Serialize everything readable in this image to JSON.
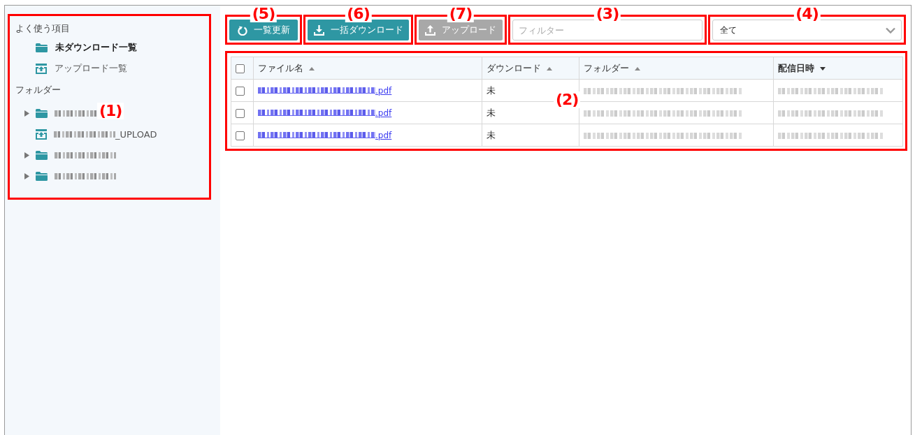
{
  "sidebar": {
    "annotation": "(1)",
    "favorites": {
      "heading": "よく使う項目",
      "items": [
        {
          "label": "未ダウンロード一覧",
          "kind": "folder",
          "selected": true
        },
        {
          "label": "アップロード一覧",
          "kind": "upload",
          "selected": false
        }
      ]
    },
    "folders": {
      "heading": "フォルダー",
      "items": [
        {
          "kind": "folder",
          "expandable": true
        },
        {
          "kind": "upload",
          "expandable": false,
          "name_suffix": "_UPLOAD"
        },
        {
          "kind": "folder",
          "expandable": true
        },
        {
          "kind": "folder",
          "expandable": true
        }
      ]
    }
  },
  "toolbar": {
    "buttons": [
      {
        "label": "一覧更新",
        "kind": "refresh",
        "disabled": false,
        "annotation": "(5)"
      },
      {
        "label": "一括ダウンロード",
        "kind": "download",
        "disabled": false,
        "annotation": "(6)"
      },
      {
        "label": "アップロード",
        "kind": "upload",
        "disabled": true,
        "annotation": "(7)"
      }
    ],
    "filter": {
      "placeholder": "フィルター",
      "annotation": "(3)"
    },
    "select": {
      "value": "全て",
      "annotation": "(4)"
    }
  },
  "table": {
    "annotation": "(2)",
    "all_checked": false,
    "columns": [
      {
        "label": "ファイル名",
        "sort_descending": false,
        "active": false
      },
      {
        "label": "ダウンロード",
        "sort_descending": false,
        "active": false
      },
      {
        "label": "フォルダー",
        "sort_descending": false,
        "active": false
      },
      {
        "label": "配信日時",
        "sort_descending": true,
        "active": true
      }
    ],
    "rows": [
      {
        "checked": false,
        "file_suffix": ".pdf",
        "download": "未"
      },
      {
        "checked": false,
        "file_suffix": ".pdf",
        "download": "未"
      },
      {
        "checked": false,
        "file_suffix": ".pdf",
        "download": "未"
      }
    ]
  }
}
